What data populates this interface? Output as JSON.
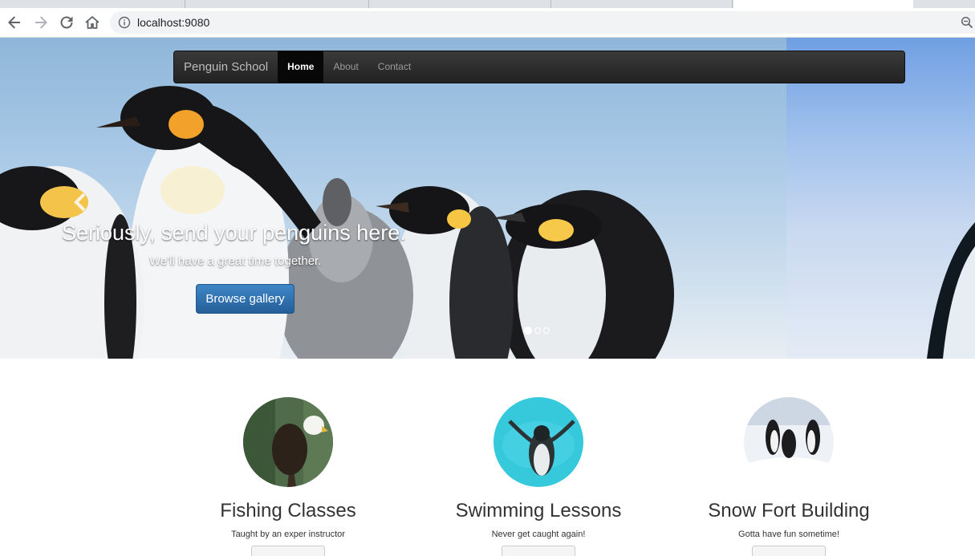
{
  "browser": {
    "url": "localhost:9080"
  },
  "navbar": {
    "brand": "Penguin School",
    "items": [
      {
        "label": "Home",
        "active": true
      },
      {
        "label": "About",
        "active": false
      },
      {
        "label": "Contact",
        "active": false
      }
    ]
  },
  "carousel": {
    "title": "Seriously, send your penguins here.",
    "subtitle": "We'll have a great time together.",
    "button_label": "Browse gallery",
    "slide_count": 3,
    "active_index": 0
  },
  "features": [
    {
      "title": "Fishing Classes",
      "text": "Taught by an exper instructor",
      "image": "eagle-photo"
    },
    {
      "title": "Swimming Lessons",
      "text": "Never get caught again!",
      "image": "penguin-swimming-photo"
    },
    {
      "title": "Snow Fort Building",
      "text": "Gotta have fun sometime!",
      "image": "penguins-snow-photo"
    }
  ],
  "colors": {
    "primary_button": "#2a6eb0",
    "navbar_bg": "#222222",
    "sky": "#a7c8e6"
  }
}
